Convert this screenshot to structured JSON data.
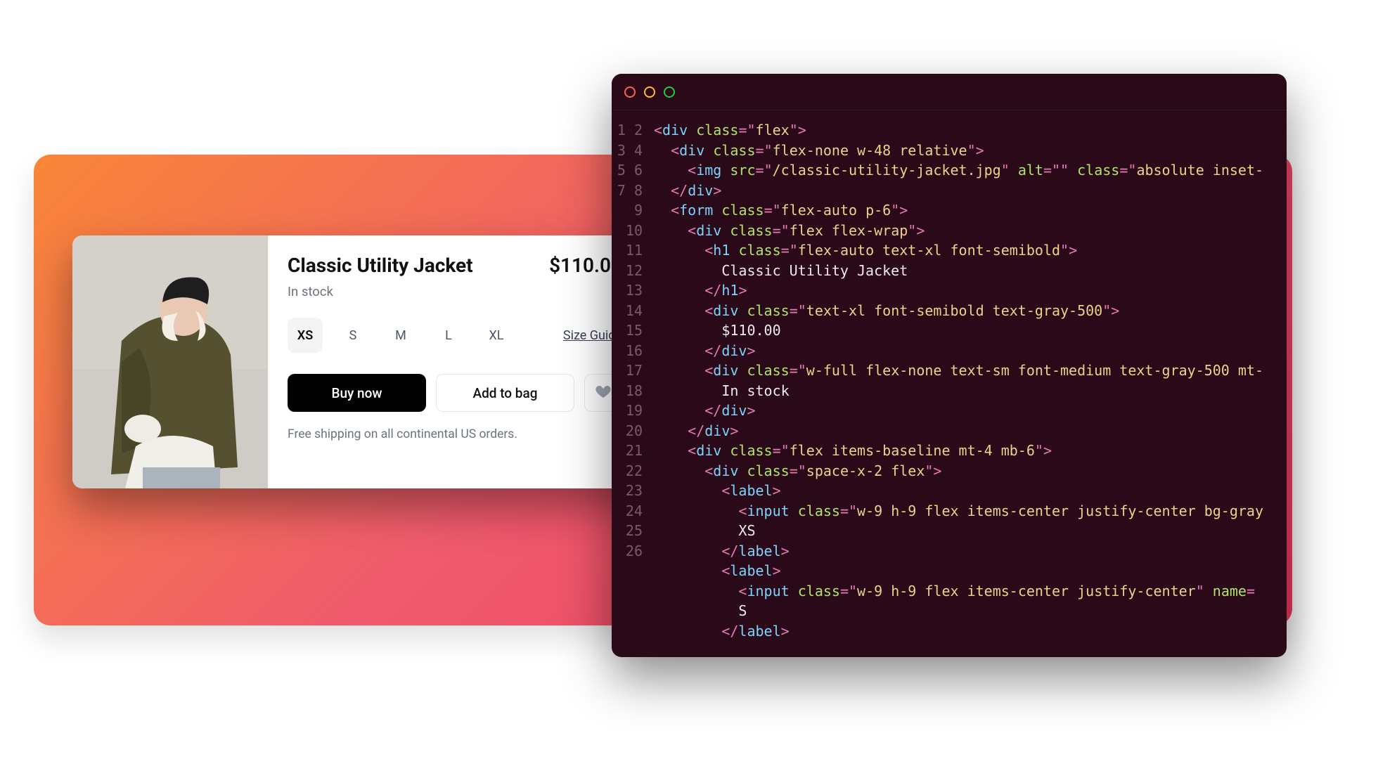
{
  "product": {
    "title": "Classic Utility Jacket",
    "price": "$110.00",
    "stock": "In stock",
    "sizes": [
      "XS",
      "S",
      "M",
      "L",
      "XL"
    ],
    "selected_size_index": 0,
    "size_guide_label": "Size Guide",
    "buy_label": "Buy now",
    "bag_label": "Add to bag",
    "shipping": "Free shipping on all continental US orders."
  },
  "editor": {
    "line_start": 1,
    "lines": [
      [
        [
          "punc",
          "<"
        ],
        [
          "tag",
          "div"
        ],
        [
          "text",
          " "
        ],
        [
          "attr",
          "class"
        ],
        [
          "punc",
          "="
        ],
        [
          "punc",
          "\""
        ],
        [
          "str",
          "flex"
        ],
        [
          "punc",
          "\""
        ],
        [
          "punc",
          ">"
        ]
      ],
      [
        [
          "text",
          "  "
        ],
        [
          "punc",
          "<"
        ],
        [
          "tag",
          "div"
        ],
        [
          "text",
          " "
        ],
        [
          "attr",
          "class"
        ],
        [
          "punc",
          "="
        ],
        [
          "punc",
          "\""
        ],
        [
          "str",
          "flex-none w-48 relative"
        ],
        [
          "punc",
          "\""
        ],
        [
          "punc",
          ">"
        ]
      ],
      [
        [
          "text",
          "    "
        ],
        [
          "punc",
          "<"
        ],
        [
          "tag",
          "img"
        ],
        [
          "text",
          " "
        ],
        [
          "attr",
          "src"
        ],
        [
          "punc",
          "="
        ],
        [
          "punc",
          "\""
        ],
        [
          "str",
          "/classic-utility-jacket.jpg"
        ],
        [
          "punc",
          "\""
        ],
        [
          "text",
          " "
        ],
        [
          "attr",
          "alt"
        ],
        [
          "punc",
          "="
        ],
        [
          "punc",
          "\""
        ],
        [
          "str",
          ""
        ],
        [
          "punc",
          "\""
        ],
        [
          "text",
          " "
        ],
        [
          "attr",
          "class"
        ],
        [
          "punc",
          "="
        ],
        [
          "punc",
          "\""
        ],
        [
          "str",
          "absolute inset-"
        ],
        [
          "text",
          ""
        ]
      ],
      [
        [
          "text",
          "  "
        ],
        [
          "punc",
          "</"
        ],
        [
          "tag",
          "div"
        ],
        [
          "punc",
          ">"
        ]
      ],
      [
        [
          "text",
          "  "
        ],
        [
          "punc",
          "<"
        ],
        [
          "tag",
          "form"
        ],
        [
          "text",
          " "
        ],
        [
          "attr",
          "class"
        ],
        [
          "punc",
          "="
        ],
        [
          "punc",
          "\""
        ],
        [
          "str",
          "flex-auto p-6"
        ],
        [
          "punc",
          "\""
        ],
        [
          "punc",
          ">"
        ]
      ],
      [
        [
          "text",
          "    "
        ],
        [
          "punc",
          "<"
        ],
        [
          "tag",
          "div"
        ],
        [
          "text",
          " "
        ],
        [
          "attr",
          "class"
        ],
        [
          "punc",
          "="
        ],
        [
          "punc",
          "\""
        ],
        [
          "str",
          "flex flex-wrap"
        ],
        [
          "punc",
          "\""
        ],
        [
          "punc",
          ">"
        ]
      ],
      [
        [
          "text",
          "      "
        ],
        [
          "punc",
          "<"
        ],
        [
          "tag",
          "h1"
        ],
        [
          "text",
          " "
        ],
        [
          "attr",
          "class"
        ],
        [
          "punc",
          "="
        ],
        [
          "punc",
          "\""
        ],
        [
          "str",
          "flex-auto text-xl font-semibold"
        ],
        [
          "punc",
          "\""
        ],
        [
          "punc",
          ">"
        ]
      ],
      [
        [
          "text",
          "        Classic Utility Jacket"
        ]
      ],
      [
        [
          "text",
          "      "
        ],
        [
          "punc",
          "</"
        ],
        [
          "tag",
          "h1"
        ],
        [
          "punc",
          ">"
        ]
      ],
      [
        [
          "text",
          "      "
        ],
        [
          "punc",
          "<"
        ],
        [
          "tag",
          "div"
        ],
        [
          "text",
          " "
        ],
        [
          "attr",
          "class"
        ],
        [
          "punc",
          "="
        ],
        [
          "punc",
          "\""
        ],
        [
          "str",
          "text-xl font-semibold text-gray-500"
        ],
        [
          "punc",
          "\""
        ],
        [
          "punc",
          ">"
        ]
      ],
      [
        [
          "text",
          "        $110.00"
        ]
      ],
      [
        [
          "text",
          "      "
        ],
        [
          "punc",
          "</"
        ],
        [
          "tag",
          "div"
        ],
        [
          "punc",
          ">"
        ]
      ],
      [
        [
          "text",
          "      "
        ],
        [
          "punc",
          "<"
        ],
        [
          "tag",
          "div"
        ],
        [
          "text",
          " "
        ],
        [
          "attr",
          "class"
        ],
        [
          "punc",
          "="
        ],
        [
          "punc",
          "\""
        ],
        [
          "str",
          "w-full flex-none text-sm font-medium text-gray-500 mt-"
        ],
        [
          "text",
          ""
        ]
      ],
      [
        [
          "text",
          "        In stock"
        ]
      ],
      [
        [
          "text",
          "      "
        ],
        [
          "punc",
          "</"
        ],
        [
          "tag",
          "div"
        ],
        [
          "punc",
          ">"
        ]
      ],
      [
        [
          "text",
          "    "
        ],
        [
          "punc",
          "</"
        ],
        [
          "tag",
          "div"
        ],
        [
          "punc",
          ">"
        ]
      ],
      [
        [
          "text",
          "    "
        ],
        [
          "punc",
          "<"
        ],
        [
          "tag",
          "div"
        ],
        [
          "text",
          " "
        ],
        [
          "attr",
          "class"
        ],
        [
          "punc",
          "="
        ],
        [
          "punc",
          "\""
        ],
        [
          "str",
          "flex items-baseline mt-4 mb-6"
        ],
        [
          "punc",
          "\""
        ],
        [
          "punc",
          ">"
        ]
      ],
      [
        [
          "text",
          "      "
        ],
        [
          "punc",
          "<"
        ],
        [
          "tag",
          "div"
        ],
        [
          "text",
          " "
        ],
        [
          "attr",
          "class"
        ],
        [
          "punc",
          "="
        ],
        [
          "punc",
          "\""
        ],
        [
          "str",
          "space-x-2 flex"
        ],
        [
          "punc",
          "\""
        ],
        [
          "punc",
          ">"
        ]
      ],
      [
        [
          "text",
          "        "
        ],
        [
          "punc",
          "<"
        ],
        [
          "tag",
          "label"
        ],
        [
          "punc",
          ">"
        ]
      ],
      [
        [
          "text",
          "          "
        ],
        [
          "punc",
          "<"
        ],
        [
          "tag",
          "input"
        ],
        [
          "text",
          " "
        ],
        [
          "attr",
          "class"
        ],
        [
          "punc",
          "="
        ],
        [
          "punc",
          "\""
        ],
        [
          "str",
          "w-9 h-9 flex items-center justify-center bg-gray"
        ],
        [
          "text",
          ""
        ]
      ],
      [
        [
          "text",
          "          XS"
        ]
      ],
      [
        [
          "text",
          "        "
        ],
        [
          "punc",
          "</"
        ],
        [
          "tag",
          "label"
        ],
        [
          "punc",
          ">"
        ]
      ],
      [
        [
          "text",
          "        "
        ],
        [
          "punc",
          "<"
        ],
        [
          "tag",
          "label"
        ],
        [
          "punc",
          ">"
        ]
      ],
      [
        [
          "text",
          "          "
        ],
        [
          "punc",
          "<"
        ],
        [
          "tag",
          "input"
        ],
        [
          "text",
          " "
        ],
        [
          "attr",
          "class"
        ],
        [
          "punc",
          "="
        ],
        [
          "punc",
          "\""
        ],
        [
          "str",
          "w-9 h-9 flex items-center justify-center"
        ],
        [
          "punc",
          "\""
        ],
        [
          "text",
          " "
        ],
        [
          "attr",
          "name"
        ],
        [
          "punc",
          "="
        ],
        [
          "text",
          ""
        ]
      ],
      [
        [
          "text",
          "          S"
        ]
      ],
      [
        [
          "text",
          "        "
        ],
        [
          "punc",
          "</"
        ],
        [
          "tag",
          "label"
        ],
        [
          "punc",
          ">"
        ]
      ]
    ],
    "jump_after_index": 16,
    "jump_to_num": 18
  }
}
